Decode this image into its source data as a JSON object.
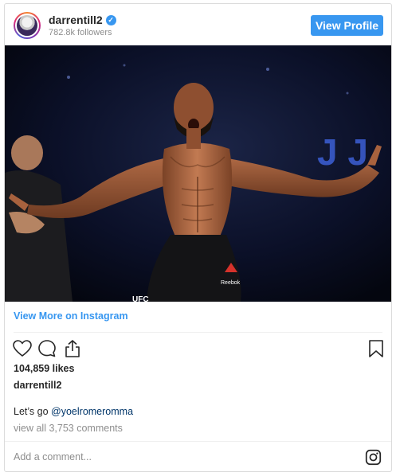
{
  "header": {
    "username": "darrentill2",
    "verified_glyph": "✓",
    "followers": "782.8k followers",
    "view_profile_label": "View Profile"
  },
  "photo": {
    "sign_text": "J J",
    "brand_text": "Reebok",
    "shorts_logo": "UFC"
  },
  "post": {
    "view_more_label": "View More on Instagram",
    "likes": "104,859 likes",
    "author": "darrentill2",
    "caption_text": "Let’s go ",
    "caption_mention": "@yoelromeromma",
    "comments_link": "view all 3,753 comments"
  },
  "comment_box": {
    "placeholder": "Add a comment..."
  },
  "icons": {
    "like": "heart-icon",
    "comment": "speech-bubble-icon",
    "share": "share-icon",
    "save": "bookmark-icon",
    "brand": "instagram-logo-icon"
  },
  "colors": {
    "accent": "#3897f0",
    "mention": "#003569",
    "muted": "#8e8e8e",
    "border": "#dbdbdb"
  }
}
